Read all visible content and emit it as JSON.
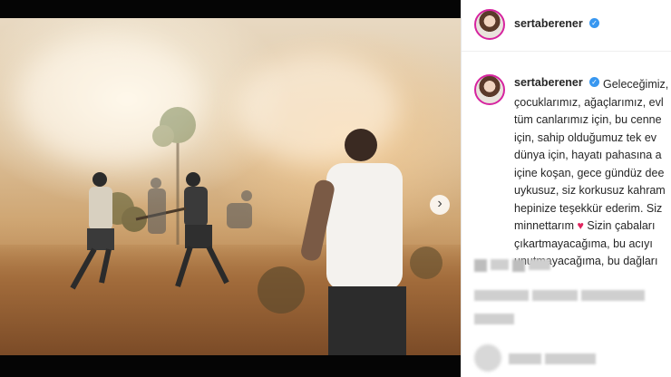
{
  "post": {
    "username": "sertaberener",
    "verified_label": "✓",
    "caption_lines": [
      "Geleceğimiz,",
      "çocuklarımız, ağaçlarımız, evl",
      "tüm canlarımız için, bu cenne",
      "için, sahip olduğumuz tek ev",
      "dünya için, hayatı pahasına a",
      "içine koşan, gece gündüz dee",
      "uykusuz, siz korkusuz kahram",
      "hepinize teşekkür ederim. Siz",
      "minnettarım",
      "Sizin çabaları",
      "çıkartmayacağıma, bu acıyı",
      "unutmayacağıma, bu dağları"
    ],
    "heart_glyph": "♥"
  },
  "carousel": {
    "next_glyph": "›",
    "dot_count": 6,
    "active_index": 0
  },
  "colors": {
    "accent": "#3897f0",
    "heart": "#e0245e"
  }
}
